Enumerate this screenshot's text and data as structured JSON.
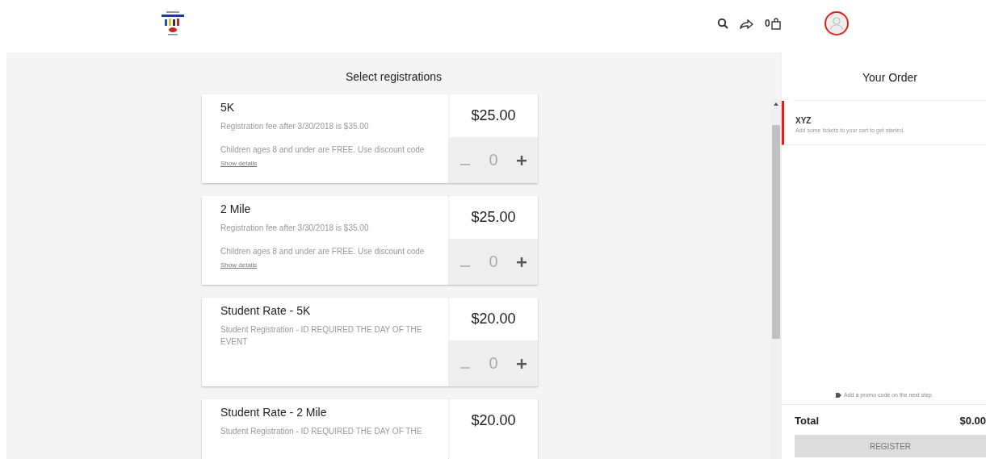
{
  "header": {
    "cart_count": "0"
  },
  "main": {
    "title": "Select registrations",
    "registrations": [
      {
        "name": "5K",
        "note": "Registration fee after 3/30/2018 is $35.00",
        "description": "Children ages 8 and under are FREE. Use discount code",
        "details_link": "Show details",
        "price": "$25.00",
        "quantity": "0"
      },
      {
        "name": "2 Mile",
        "note": "Registration fee after 3/30/2018 is $35.00",
        "description": "Children ages 8 and under are FREE. Use discount code",
        "details_link": "Show details",
        "price": "$25.00",
        "quantity": "0"
      },
      {
        "name": "Student Rate - 5K",
        "note": "Student Registration - ID REQUIRED THE DAY OF THE EVENT",
        "price": "$20.00",
        "quantity": "0"
      },
      {
        "name": "Student Rate - 2 Mile",
        "note": "Student Registration - ID REQUIRED THE DAY OF THE",
        "price": "$20.00"
      }
    ]
  },
  "order": {
    "title": "Your Order",
    "event": "XYZ",
    "message": "Add some tickets to your cart to get started.",
    "promo": "Add a promo code on the next step",
    "total_label": "Total",
    "total": "$0.00",
    "register_button": "REGISTER",
    "register_disabled": true
  }
}
